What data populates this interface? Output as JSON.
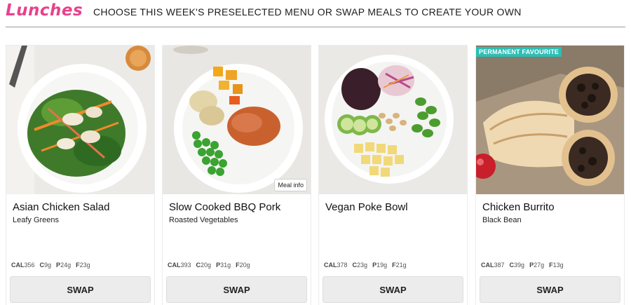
{
  "header": {
    "title": "Lunches",
    "subtitle": "CHOOSE THIS WEEK'S PRESELECTED MENU OR SWAP MEALS TO CREATE YOUR OWN"
  },
  "colors": {
    "accent": "#e8418c",
    "badge": "#2bbfb6",
    "button": "#ececec"
  },
  "meals": [
    {
      "name": "Asian Chicken Salad",
      "side": "Leafy Greens",
      "nutrition": {
        "cal": "356",
        "c": "9g",
        "p": "24g",
        "f": "23g"
      },
      "swap_label": "SWAP",
      "image": "asian-chicken-salad-photo"
    },
    {
      "name": "Slow Cooked BBQ Pork",
      "side": "Roasted Vegetables",
      "nutrition": {
        "cal": "393",
        "c": "20g",
        "p": "31g",
        "f": "20g"
      },
      "swap_label": "SWAP",
      "meal_info_label": "Meal info",
      "image": "bbq-pork-photo"
    },
    {
      "name": "Vegan Poke Bowl",
      "side": "",
      "nutrition": {
        "cal": "378",
        "c": "23g",
        "p": "19g",
        "f": "21g"
      },
      "swap_label": "SWAP",
      "image": "vegan-poke-bowl-photo"
    },
    {
      "name": "Chicken Burrito",
      "side": "Black Bean",
      "nutrition": {
        "cal": "387",
        "c": "39g",
        "p": "27g",
        "f": "13g"
      },
      "swap_label": "SWAP",
      "badge": "PERMANENT FAVOURITE",
      "image": "chicken-burrito-photo"
    }
  ],
  "nutrition_labels": {
    "cal": "CAL",
    "c": "C",
    "p": "P",
    "f": "F"
  }
}
